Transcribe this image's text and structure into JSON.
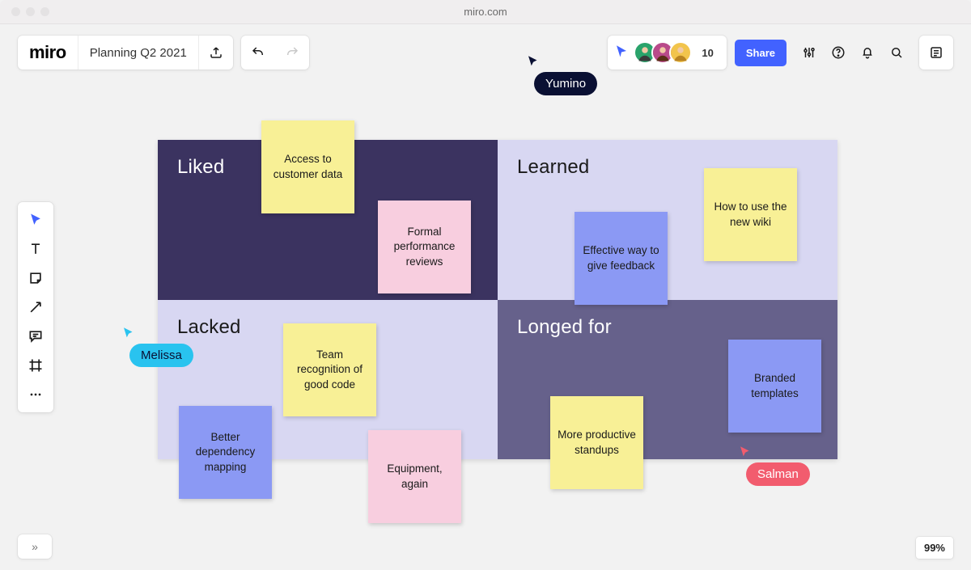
{
  "browser": {
    "url": "miro.com"
  },
  "header": {
    "logo": "miro",
    "board_title": "Planning Q2 2021",
    "share_label": "Share",
    "presence_count": "10"
  },
  "quadrants": {
    "liked": {
      "title": "Liked"
    },
    "learned": {
      "title": "Learned"
    },
    "lacked": {
      "title": "Lacked"
    },
    "longed": {
      "title": "Longed for"
    }
  },
  "notes": {
    "access_customer_data": "Access to customer data",
    "formal_reviews": "Formal performance reviews",
    "effective_feedback": "Effective way to give feedback",
    "new_wiki": "How to use the new wiki",
    "team_recognition": "Team recognition of good code",
    "dependency_mapping": "Better dependency mapping",
    "equipment_again": "Equipment, again",
    "productive_standups": "More productive standups",
    "branded_templates": "Branded templates"
  },
  "cursors": {
    "yumino": "Yumino",
    "melissa": "Melissa",
    "salman": "Salman"
  },
  "footer": {
    "zoom": "99%",
    "expand": "»"
  },
  "colors": {
    "accent": "#4262ff",
    "quad_dark": "#3b3360",
    "quad_light": "#d8d7f2",
    "quad_mid": "#66618b",
    "sticky_yellow": "#f8f096",
    "sticky_pink": "#f8cedf",
    "sticky_blue": "#8b99f4",
    "cursor_yumino": "#0a1033",
    "cursor_melissa": "#29c3ef",
    "cursor_salman": "#f25c6e"
  }
}
